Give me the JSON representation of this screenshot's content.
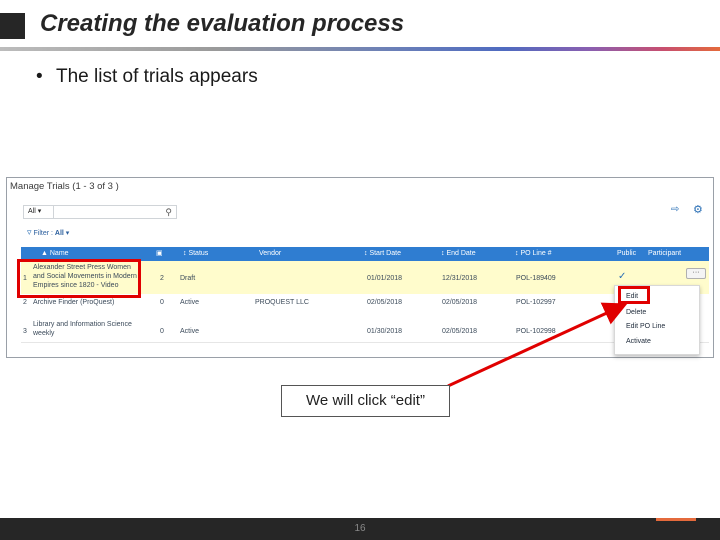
{
  "slide": {
    "title": "Creating the evaluation process",
    "bullet": "The list of trials appears",
    "callout": "We will click “edit”",
    "page_number": "16"
  },
  "screenshot": {
    "title": "Manage Trials (1 - 3 of 3 )",
    "scope_label": "All",
    "search_value": "",
    "filter_label": "Filter :",
    "filter_value": "All",
    "columns": [
      "▲ Name",
      "▣",
      "↕ Status",
      "Vendor",
      "↕ Start Date",
      "↕ End Date",
      "↕ PO Line #",
      "Public",
      "Participant"
    ],
    "rows": [
      {
        "num": "1",
        "name_lines": [
          "Alexander Street Press Women",
          "and Social Movements in Modern",
          "Empires since 1820 - Video"
        ],
        "count": "2",
        "status": "Draft",
        "vendor": "",
        "start": "01/01/2018",
        "end": "12/31/2018",
        "po_line": "POL-189409",
        "public": "✓"
      },
      {
        "num": "2",
        "name_lines": [
          "Archive Finder (ProQuest)"
        ],
        "count": "0",
        "status": "Active",
        "vendor": "PROQUEST LLC",
        "start": "02/05/2018",
        "end": "02/05/2018",
        "po_line": "POL-102997",
        "public": ""
      },
      {
        "num": "3",
        "name_lines": [
          "Library and Information Science",
          "weekly"
        ],
        "count": "0",
        "status": "Active",
        "vendor": "",
        "start": "01/30/2018",
        "end": "02/05/2018",
        "po_line": "POL-102998",
        "public": ""
      }
    ],
    "row_actions_label": "···",
    "menu": [
      "Edit",
      "Delete",
      "Edit PO Line",
      "Activate"
    ]
  },
  "colors": {
    "header_blue": "#2f7dd1",
    "highlight_row": "#fffccc",
    "annotation_red": "#e00000"
  },
  "icons": {
    "search": "search-icon",
    "export": "export-icon",
    "settings": "gear-icon",
    "filter": "filter-icon",
    "check": "check-icon"
  }
}
